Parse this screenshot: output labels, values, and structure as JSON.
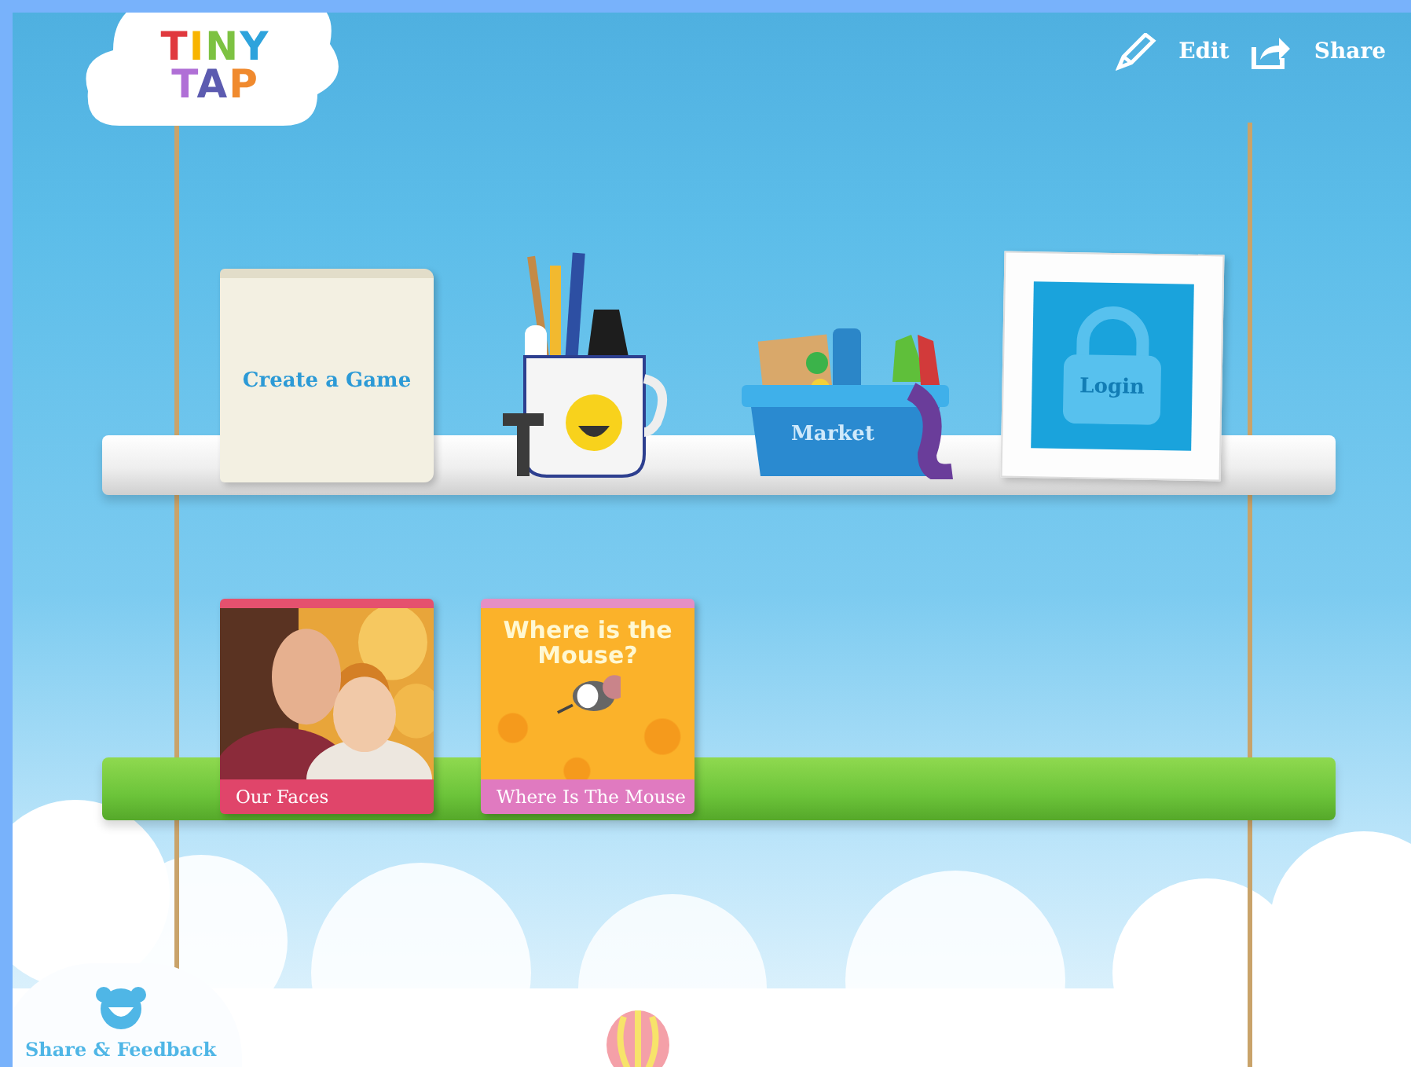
{
  "logo": {
    "lines": [
      "TINY",
      "TAP"
    ]
  },
  "toolbar": [
    {
      "kind": "edit",
      "label": "Edit"
    },
    {
      "kind": "share",
      "label": "Share"
    }
  ],
  "shelves": [
    {
      "kind": "white",
      "items": [
        {
          "kind": "book",
          "label": "Create a Game"
        },
        {
          "kind": "mug"
        },
        {
          "kind": "basket",
          "label": "Market"
        },
        {
          "kind": "frame",
          "label": "Login"
        }
      ]
    },
    {
      "kind": "green",
      "items": [
        {
          "kind": "photo-book",
          "label": "Our Faces"
        },
        {
          "kind": "cover-book",
          "cover_title": "Where is the Mouse?",
          "label": "Where Is The Mouse"
        }
      ]
    }
  ],
  "feedback": {
    "label": "Share & Feedback"
  }
}
